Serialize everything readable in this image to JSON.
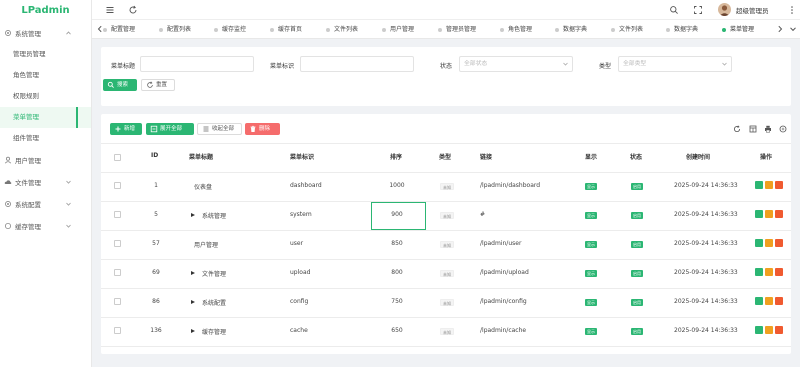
{
  "app": {
    "logo": "LPadmin"
  },
  "sidebar": {
    "groups": [
      {
        "label": "系统管理",
        "icon": "gear-icon",
        "expanded": true,
        "items": [
          "管理员管理",
          "角色管理",
          "权限规则",
          "菜单管理",
          "组件管理"
        ]
      },
      {
        "label": "用户管理",
        "icon": "user-icon"
      },
      {
        "label": "文件管理",
        "icon": "cloud-icon"
      },
      {
        "label": "系统配置",
        "icon": "gear-icon"
      },
      {
        "label": "缓存管理",
        "icon": "circle-icon"
      }
    ],
    "active_item": "菜单管理"
  },
  "topbar": {
    "user_name": "超级管理员"
  },
  "tabs": [
    "配置管理",
    "配置列表",
    "缓存监控",
    "缓存首页",
    "文件列表",
    "用户管理",
    "管理员管理",
    "角色管理",
    "数据字典",
    "文件列表",
    "数据字典",
    "菜单管理"
  ],
  "active_tab": "菜单管理",
  "search": {
    "title_label": "菜单标题",
    "key_label": "菜单标识",
    "status_label": "状态",
    "status_placeholder": "全部状态",
    "type_label": "类型",
    "type_placeholder": "全部类型",
    "search_button": "搜索",
    "reset_button": "重置"
  },
  "toolbar": {
    "add": "新增",
    "expand_all": "展开全部",
    "collapse_all": "收起全部",
    "delete": "删除"
  },
  "table": {
    "headers": {
      "id": "ID",
      "title": "菜单标题",
      "key": "菜单标识",
      "sort": "排序",
      "type": "类型",
      "link": "链接",
      "display": "显示",
      "status": "状态",
      "created": "创建时间",
      "actions": "操作"
    },
    "rows": [
      {
        "id": "1",
        "title": "仪表盘",
        "key": "dashboard",
        "sort": "1000",
        "type": "未知",
        "link": "/lpadmin/dashboard",
        "display": "显示",
        "status": "启用",
        "created": "2025-09-24 14:36:33",
        "expandable": false
      },
      {
        "id": "5",
        "title": "系统管理",
        "key": "system",
        "sort": "900",
        "type": "未知",
        "link": "#",
        "display": "显示",
        "status": "启用",
        "created": "2025-09-24 14:36:33",
        "expandable": true
      },
      {
        "id": "57",
        "title": "用户管理",
        "key": "user",
        "sort": "850",
        "type": "未知",
        "link": "/lpadmin/user",
        "display": "显示",
        "status": "启用",
        "created": "2025-09-24 14:36:33",
        "expandable": false
      },
      {
        "id": "69",
        "title": "文件管理",
        "key": "upload",
        "sort": "800",
        "type": "未知",
        "link": "/lpadmin/upload",
        "display": "显示",
        "status": "启用",
        "created": "2025-09-24 14:36:33",
        "expandable": true
      },
      {
        "id": "86",
        "title": "系统配置",
        "key": "config",
        "sort": "750",
        "type": "未知",
        "link": "/lpadmin/config",
        "display": "显示",
        "status": "启用",
        "created": "2025-09-24 14:36:33",
        "expandable": true
      },
      {
        "id": "136",
        "title": "缓存管理",
        "key": "cache",
        "sort": "650",
        "type": "未知",
        "link": "/lpadmin/cache",
        "display": "显示",
        "status": "启用",
        "created": "2025-09-24 14:36:33",
        "expandable": true
      }
    ]
  },
  "colors": {
    "primary": "#2bb673",
    "danger": "#f56c6c",
    "warning": "#f0a020",
    "action_red": "#f05a30"
  }
}
